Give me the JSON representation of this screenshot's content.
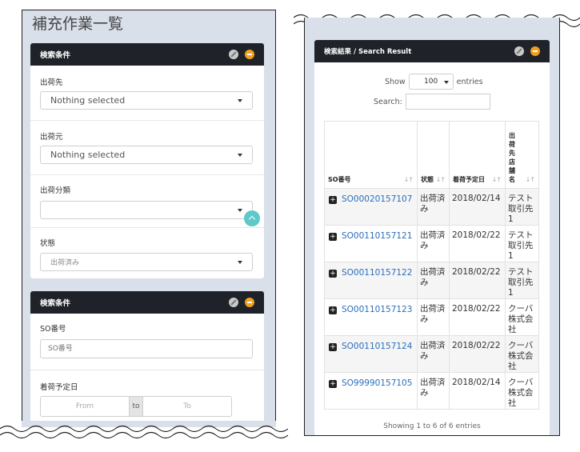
{
  "left": {
    "page_title": "補充作業一覧",
    "box1": {
      "header": "検索条件",
      "fields": [
        {
          "label": "出荷先",
          "value": "Nothing selected"
        },
        {
          "label": "出荷元",
          "value": "Nothing selected"
        },
        {
          "label": "出荷分類",
          "value": ""
        },
        {
          "label": "状態",
          "value": "出荷済み"
        }
      ]
    },
    "box2": {
      "header": "検索条件",
      "so_label": "SO番号",
      "so_placeholder": "SO番号",
      "date_label": "着荷予定日",
      "date_from": "From",
      "date_to_label": "to",
      "date_to": "To"
    }
  },
  "right": {
    "header": "検索結果 / Search Result",
    "show_label": "Show",
    "length_value": "100",
    "entries_label": "entries",
    "search_label": "Search:",
    "columns": [
      "SO番号",
      "状態",
      "着荷予定日",
      "出荷先店舗名"
    ],
    "rows": [
      {
        "so": "SO00020157107",
        "status": "出荷済み",
        "date": "2018/02/14",
        "store": "テスト取引先1"
      },
      {
        "so": "SO00110157121",
        "status": "出荷済み",
        "date": "2018/02/22",
        "store": "テスト取引先1"
      },
      {
        "so": "SO00110157122",
        "status": "出荷済み",
        "date": "2018/02/22",
        "store": "テスト取引先1"
      },
      {
        "so": "SO00110157123",
        "status": "出荷済み",
        "date": "2018/02/22",
        "store": "クーバ株式会社"
      },
      {
        "so": "SO00110157124",
        "status": "出荷済み",
        "date": "2018/02/22",
        "store": "クーバ株式会社"
      },
      {
        "so": "SO99990157105",
        "status": "出荷済み",
        "date": "2018/02/14",
        "store": "クーバ株式会社"
      }
    ],
    "info": "Showing 1 to 6 of 6 entries"
  },
  "colors": {
    "header_bg": "#1f2329",
    "panel_bg": "#d9e0ea",
    "link": "#2a6ebb",
    "minimize": "#f0a020",
    "fab": "#5fc8c8"
  }
}
